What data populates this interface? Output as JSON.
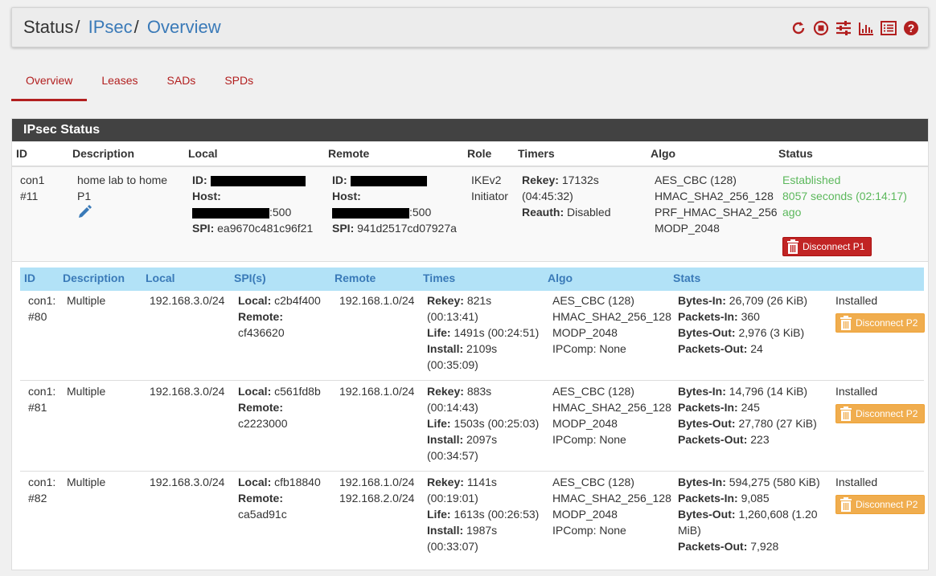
{
  "header": {
    "crumb_status": "Status",
    "crumb_ipsec": "IPsec",
    "crumb_overview": "Overview",
    "icons": [
      "reload-icon",
      "stop-icon",
      "settings-icon",
      "chart-icon",
      "log-icon",
      "help-icon"
    ]
  },
  "tabs": [
    "Overview",
    "Leases",
    "SADs",
    "SPDs"
  ],
  "panel_title": "IPsec Status",
  "p1_headers": [
    "ID",
    "Description",
    "Local",
    "Remote",
    "Role",
    "Timers",
    "Algo",
    "Status"
  ],
  "p1": {
    "id1": "con1",
    "id2": "#11",
    "desc1": "home lab to home",
    "desc2": "P1",
    "id_label": "ID:",
    "host_label": "Host:",
    "spi_label": "SPI:",
    "local_port": ":500",
    "local_spi": "ea9670c481c96f21",
    "remote_port": ":500",
    "remote_spi": "941d2517cd07927a",
    "role1": "IKEv2",
    "role2": "Initiator",
    "rekey_label": "Rekey:",
    "rekey": "17132s",
    "rekey2": "(04:45:32)",
    "reauth_label": "Reauth:",
    "reauth": "Disabled",
    "algo": [
      "AES_CBC (128)",
      "HMAC_SHA2_256_128",
      "PRF_HMAC_SHA2_256",
      "MODP_2048"
    ],
    "status1": "Established",
    "status2": "8057 seconds (02:14:17)",
    "status3": "ago",
    "disconnect": "Disconnect P1"
  },
  "p2_headers": [
    "ID",
    "Description",
    "Local",
    "SPI(s)",
    "Remote",
    "Times",
    "Algo",
    "Stats"
  ],
  "p2_labels": {
    "local": "Local:",
    "remote": "Remote:",
    "rekey": "Rekey:",
    "life": "Life:",
    "install": "Install:",
    "bytes_in": "Bytes-In:",
    "packets_in": "Packets-In:",
    "bytes_out": "Bytes-Out:",
    "packets_out": "Packets-Out:",
    "disconnect": "Disconnect P2"
  },
  "p2": [
    {
      "id1": "con1:",
      "id2": "#80",
      "desc": "Multiple",
      "local": "192.168.3.0/24",
      "spi_local": "c2b4f400",
      "spi_remote": "cf436620",
      "remote1": "192.168.1.0/24",
      "remote2": "",
      "rekey": "821s",
      "rekey2": "(00:13:41)",
      "life": "1491s (00:24:51)",
      "install": "2109s",
      "install2": "(00:35:09)",
      "algo": [
        "AES_CBC (128)",
        "HMAC_SHA2_256_128",
        "MODP_2048",
        "IPComp: None"
      ],
      "bytes_in": "26,709 (26 KiB)",
      "packets_in": "360",
      "bytes_out": "2,976 (3 KiB)",
      "bytes_out2": "",
      "packets_out": "24",
      "state": "Installed"
    },
    {
      "id1": "con1:",
      "id2": "#81",
      "desc": "Multiple",
      "local": "192.168.3.0/24",
      "spi_local": "c561fd8b",
      "spi_remote": "c2223000",
      "remote1": "192.168.1.0/24",
      "remote2": "",
      "rekey": "883s",
      "rekey2": "(00:14:43)",
      "life": "1503s (00:25:03)",
      "install": "2097s",
      "install2": "(00:34:57)",
      "algo": [
        "AES_CBC (128)",
        "HMAC_SHA2_256_128",
        "MODP_2048",
        "IPComp: None"
      ],
      "bytes_in": "14,796 (14 KiB)",
      "packets_in": "245",
      "bytes_out": "27,780 (27 KiB)",
      "bytes_out2": "",
      "packets_out": "223",
      "state": "Installed"
    },
    {
      "id1": "con1:",
      "id2": "#82",
      "desc": "Multiple",
      "local": "192.168.3.0/24",
      "spi_local": "cfb18840",
      "spi_remote": "ca5ad91c",
      "remote1": "192.168.1.0/24",
      "remote2": "192.168.2.0/24",
      "rekey": "1141s",
      "rekey2": "(00:19:01)",
      "life": "1613s (00:26:53)",
      "install": "1987s",
      "install2": "(00:33:07)",
      "algo": [
        "AES_CBC (128)",
        "HMAC_SHA2_256_128",
        "MODP_2048",
        "IPComp: None"
      ],
      "bytes_in": "594,275 (580 KiB)",
      "packets_in": "9,085",
      "bytes_out": "1,260,608 (1.20",
      "bytes_out2": "MiB)",
      "packets_out": "7,928",
      "state": "Installed"
    }
  ]
}
